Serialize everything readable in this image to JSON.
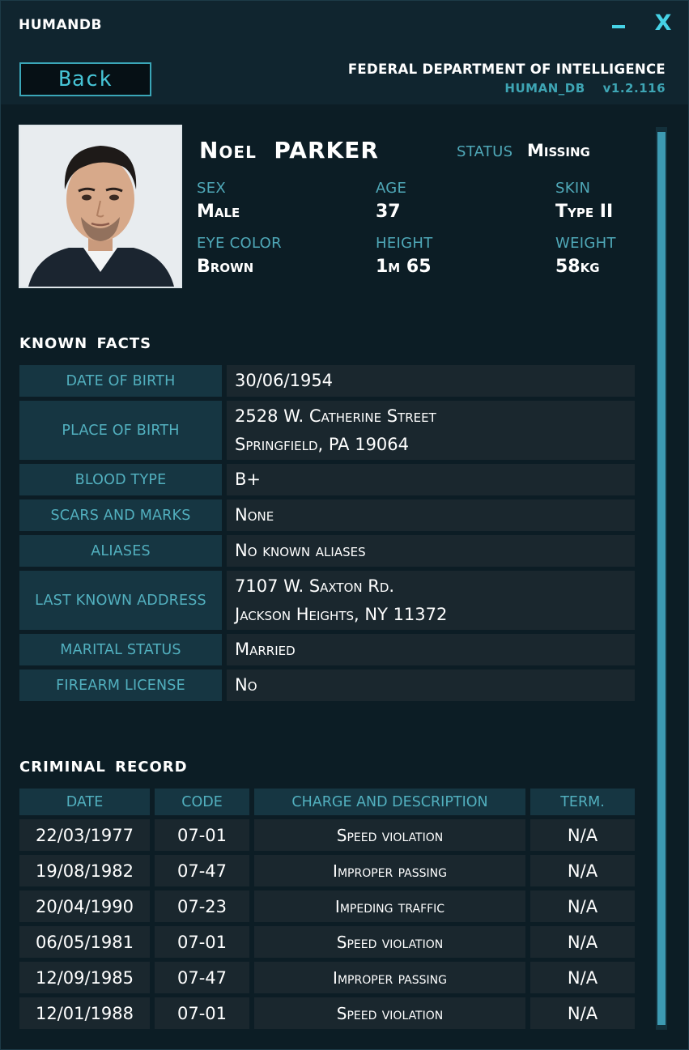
{
  "window": {
    "app_title": "HUMANDB",
    "minimize": "–",
    "close": "X"
  },
  "header": {
    "back_label": "Back",
    "agency": "FEDERAL DEPARTMENT OF INTELLIGENCE",
    "db_name": "HUMAN_DB",
    "version": "v1.2.116"
  },
  "profile": {
    "first_name": "Noel",
    "last_name": "PARKER",
    "status_label": "STATUS",
    "status_value": "Missing",
    "attributes": [
      {
        "label": "SEX",
        "value": "Male"
      },
      {
        "label": "AGE",
        "value": "37"
      },
      {
        "label": "SKIN",
        "value": "Type II"
      },
      {
        "label": "EYE COLOR",
        "value": "Brown"
      },
      {
        "label": "HEIGHT",
        "value": "1m 65"
      },
      {
        "label": "WEIGHT",
        "value": "58kg"
      }
    ]
  },
  "known_facts": {
    "title": "KNOWN FACTS",
    "rows": [
      {
        "key": "DATE OF BIRTH",
        "lines": [
          "30/06/1954"
        ]
      },
      {
        "key": "PLACE OF BIRTH",
        "lines": [
          "2528 W. Catherine Street",
          "Springfield, PA 19064"
        ]
      },
      {
        "key": "BLOOD TYPE",
        "lines": [
          "B+"
        ]
      },
      {
        "key": "SCARS AND MARKS",
        "lines": [
          "None"
        ]
      },
      {
        "key": "ALIASES",
        "lines": [
          "No known aliases"
        ]
      },
      {
        "key": "LAST KNOWN ADDRESS",
        "lines": [
          "7107 W. Saxton Rd.",
          "Jackson Heights, NY 11372"
        ]
      },
      {
        "key": "MARITAL STATUS",
        "lines": [
          "Married"
        ]
      },
      {
        "key": "FIREARM LICENSE",
        "lines": [
          "No"
        ]
      }
    ]
  },
  "criminal_record": {
    "title": "CRIMINAL RECORD",
    "columns": [
      "DATE",
      "CODE",
      "CHARGE AND DESCRIPTION",
      "TERM."
    ],
    "rows": [
      [
        "22/03/1977",
        "07-01",
        "Speed violation",
        "N/A"
      ],
      [
        "19/08/1982",
        "07-47",
        "Improper passing",
        "N/A"
      ],
      [
        "20/04/1990",
        "07-23",
        "Impeding traffic",
        "N/A"
      ],
      [
        "06/05/1981",
        "07-01",
        "Speed violation",
        "N/A"
      ],
      [
        "12/09/1985",
        "07-47",
        "Improper passing",
        "N/A"
      ],
      [
        "12/01/1988",
        "07-01",
        "Speed violation",
        "N/A"
      ]
    ]
  },
  "colors": {
    "accent": "#46d3e6",
    "label": "#4fa8b8",
    "background": "#0c1d25",
    "key_cell": "#163642",
    "value_cell": "#1a272e"
  },
  "icons": {
    "minimize": "minimize-icon",
    "close": "close-icon",
    "photo": "portrait-photo"
  }
}
